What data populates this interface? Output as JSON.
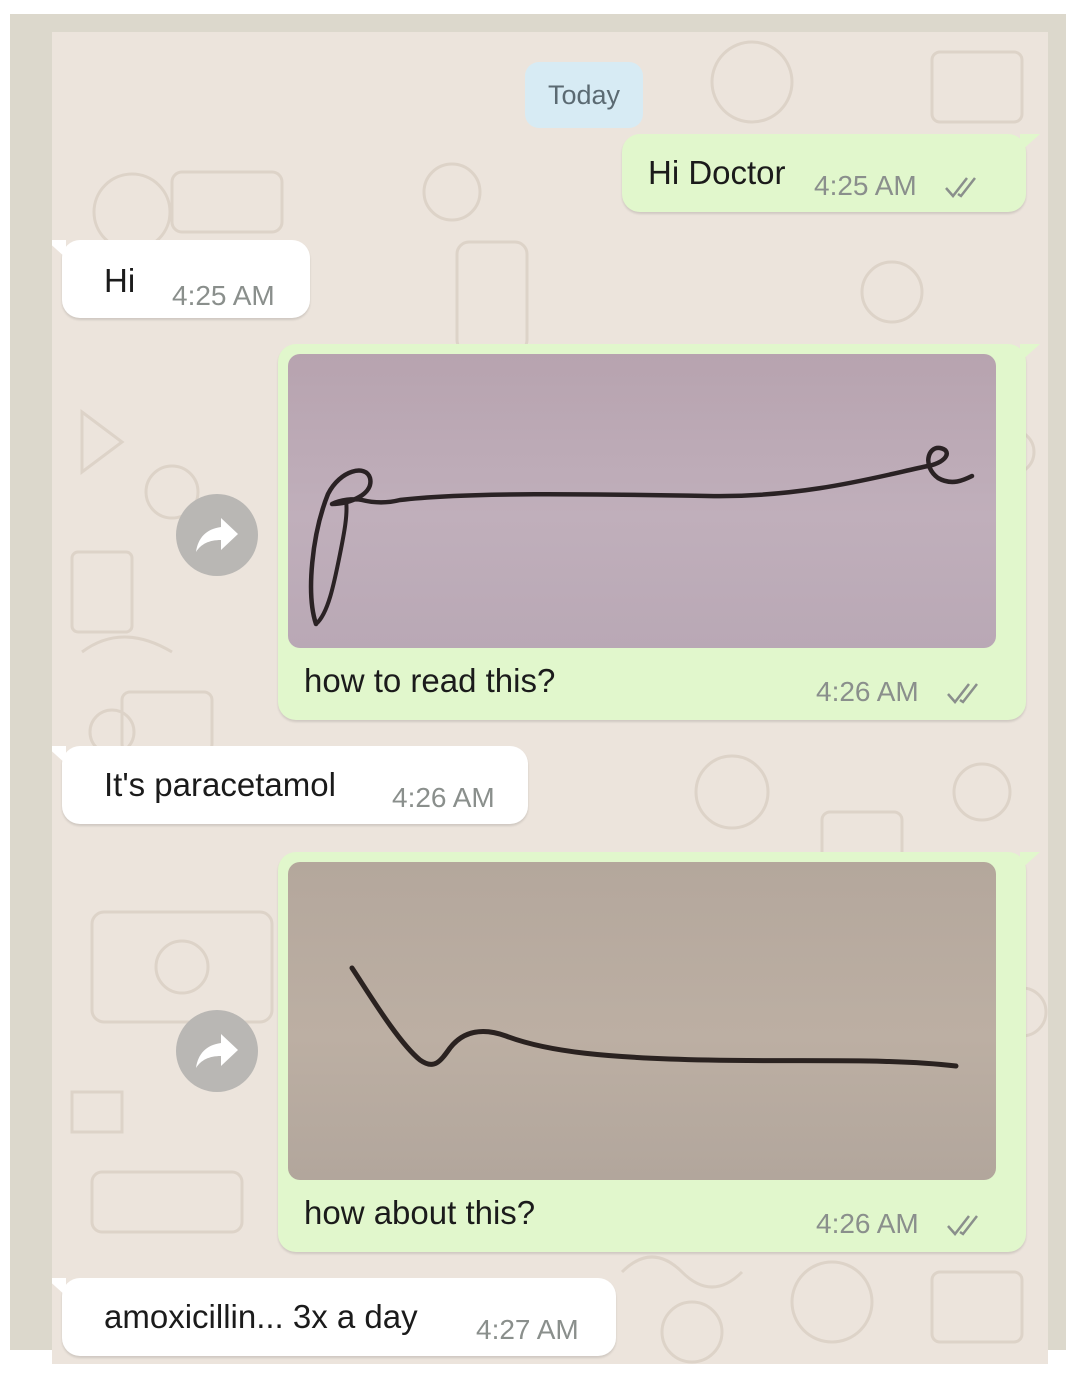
{
  "date_divider": "Today",
  "messages": [
    {
      "direction": "outgoing",
      "type": "text",
      "text": "Hi Doctor",
      "time": "4:25 AM",
      "status": "read"
    },
    {
      "direction": "incoming",
      "type": "text",
      "text": "Hi",
      "time": "4:25 AM"
    },
    {
      "direction": "outgoing",
      "type": "image",
      "image_desc": "handwritten-signature",
      "caption": "how to read this?",
      "time": "4:26 AM",
      "status": "read"
    },
    {
      "direction": "incoming",
      "type": "text",
      "text": "It's paracetamol",
      "time": "4:26 AM"
    },
    {
      "direction": "outgoing",
      "type": "image",
      "image_desc": "handwritten-squiggle",
      "caption": "how about this?",
      "time": "4:26 AM",
      "status": "read"
    },
    {
      "direction": "incoming",
      "type": "text",
      "text": "amoxicillin... 3x a day",
      "time": "4:27 AM"
    }
  ],
  "icons": {
    "forward": "forward-share-icon",
    "read_receipt": "double-check-icon"
  },
  "colors": {
    "chat_background": "#ece4dc",
    "outgoing_bubble": "#e1f7cc",
    "incoming_bubble": "#ffffff",
    "date_pill": "#d7ebf4",
    "timestamp": "#8a8f8c"
  }
}
